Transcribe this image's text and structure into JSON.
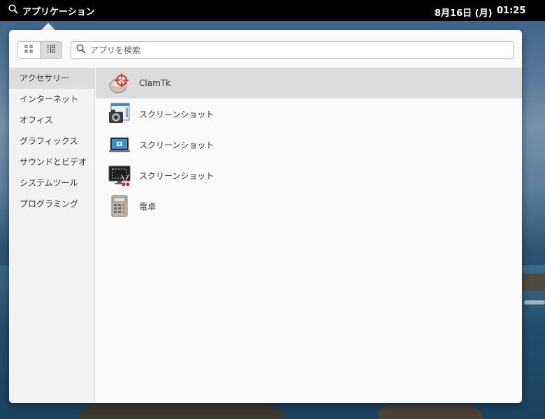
{
  "topbar": {
    "menu_label": "アプリケーション",
    "date": "8月16日 (月)",
    "time": "01:25"
  },
  "launcher": {
    "search_placeholder": "アプリを検索",
    "view_modes": [
      "grid",
      "category"
    ],
    "active_view": "category",
    "categories": [
      "アクセサリー",
      "インターネット",
      "オフィス",
      "グラフィックス",
      "サウンドとビデオ",
      "システムツール",
      "プログラミング"
    ],
    "active_category": "アクセサリー",
    "apps": [
      {
        "label": "ClamTk",
        "icon": "clamtk-icon"
      },
      {
        "label": "スクリーンショット",
        "icon": "screenshot-camera-icon"
      },
      {
        "label": "スクリーンショット",
        "icon": "screenshot-laptop-icon"
      },
      {
        "label": "スクリーンショット",
        "icon": "screenshot-monitor-icon"
      },
      {
        "label": "電卓",
        "icon": "calculator-icon"
      }
    ]
  }
}
